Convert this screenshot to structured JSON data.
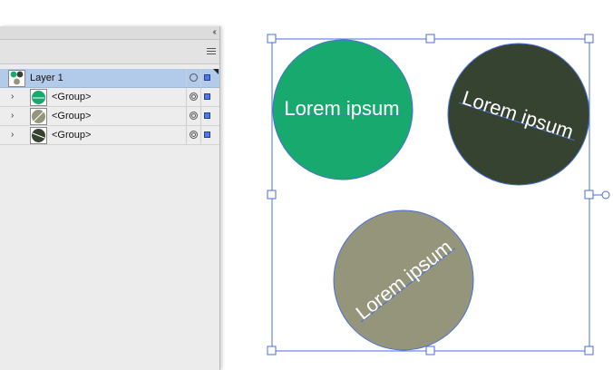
{
  "panel": {
    "collapse_glyph": "‹‹",
    "layers": [
      {
        "label": "Layer 1",
        "selected": true,
        "thumb": "layer-thumb"
      },
      {
        "label": "<Group>",
        "selected": false,
        "thumb": "green-circle",
        "chevron": "›"
      },
      {
        "label": "<Group>",
        "selected": false,
        "thumb": "khaki-circle",
        "chevron": "›"
      },
      {
        "label": "<Group>",
        "selected": false,
        "thumb": "dark-circle",
        "chevron": "›"
      }
    ]
  },
  "canvas": {
    "circles": [
      {
        "text": "Lorem ipsum",
        "fill": "#18a96f",
        "rotation_deg": 0
      },
      {
        "text": "Lorem ipsum",
        "fill": "#374331",
        "rotation_deg": 18
      },
      {
        "text": "Lorem ipsum",
        "fill": "#95957c",
        "rotation_deg": -38
      }
    ],
    "selection_color": "#4a6fd8"
  }
}
